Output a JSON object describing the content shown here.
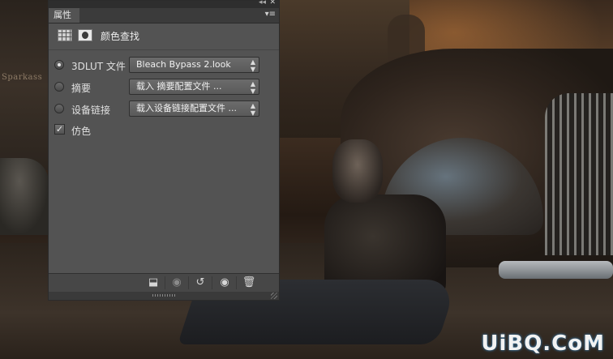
{
  "panel": {
    "tab_label": "属性",
    "menu_icon": "panel-menu-icon",
    "collapse_label": "◂◂",
    "close_label": "✕",
    "adjustment_title": "颜色查找",
    "rows": {
      "lut3d": {
        "label": "3DLUT 文件",
        "value": "Bleach Bypass 2.look",
        "selected": true
      },
      "abstract": {
        "label": "摘要",
        "value": "载入 摘要配置文件 ...",
        "selected": false
      },
      "devicelink": {
        "label": "设备链接",
        "value": "载入设备链接配置文件 ...",
        "selected": false
      }
    },
    "dither": {
      "label": "仿色",
      "checked": true,
      "mark": "✓"
    },
    "toolbar": {
      "clip": "⬓",
      "view_previous": "◉",
      "reset": "↺",
      "visibility": "◉",
      "delete": "🗑"
    }
  },
  "background": {
    "sign_text": "Sparkass",
    "watermark": "UiBQ.CoM"
  }
}
